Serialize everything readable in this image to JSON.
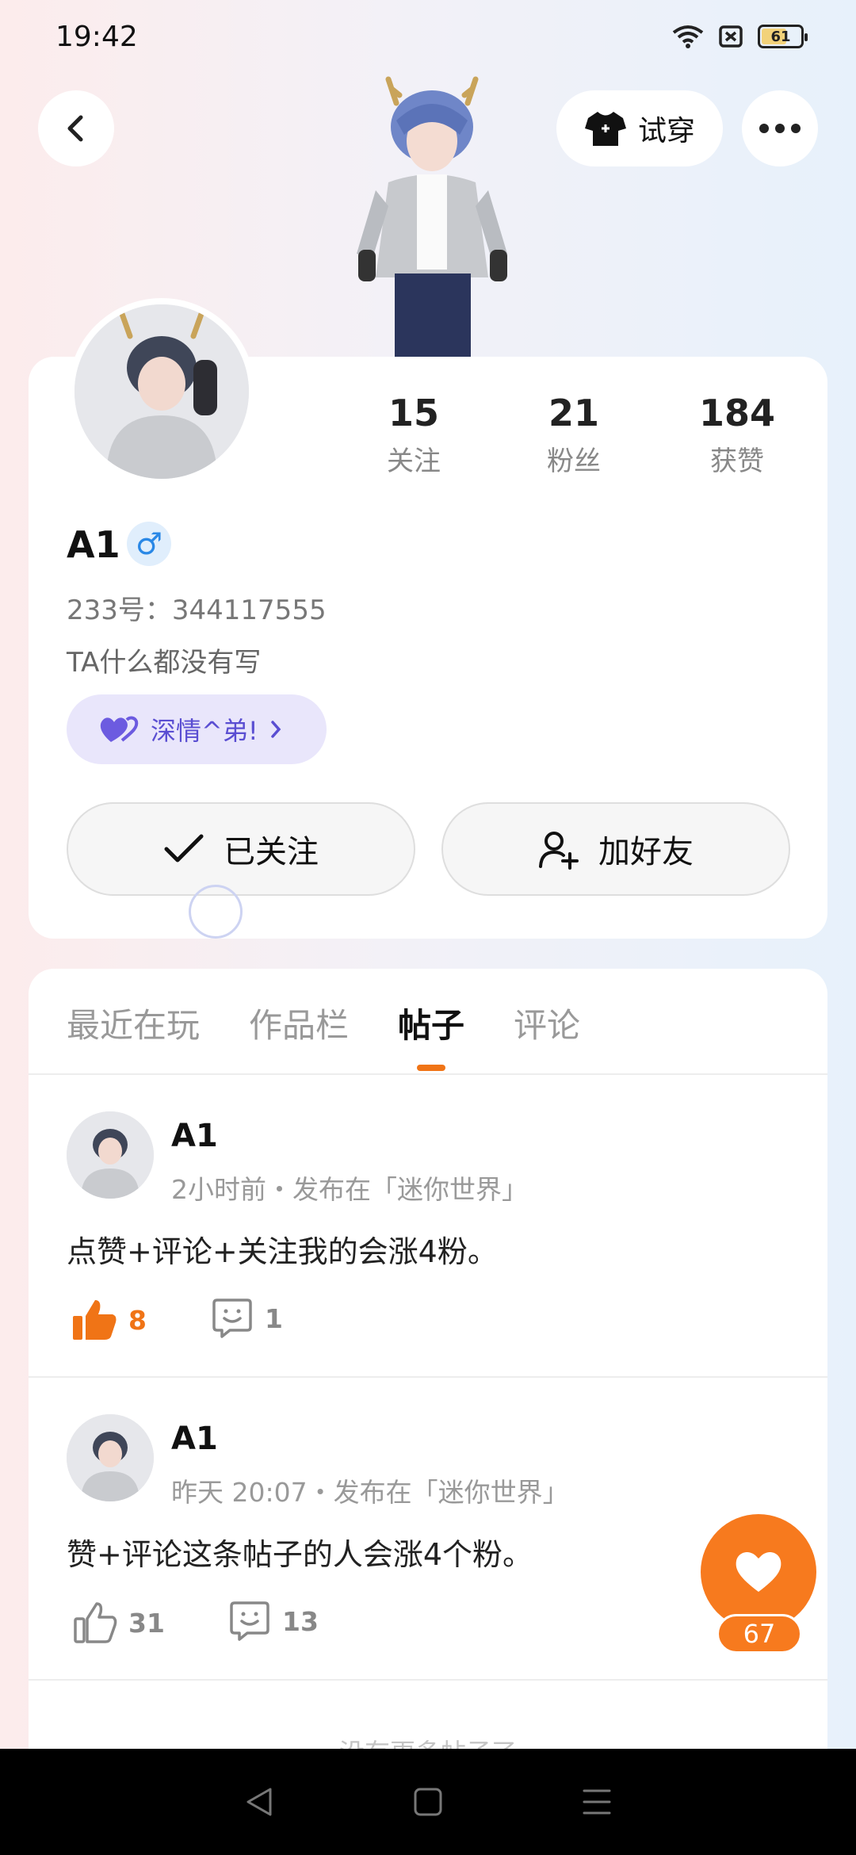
{
  "status_bar": {
    "time": "19:42",
    "battery": "61",
    "icons": [
      "wifi-icon",
      "sim-blocked-icon",
      "battery-icon"
    ]
  },
  "header": {
    "try_on_label": "试穿",
    "icons": [
      "back-arrow-icon",
      "tshirt-icon",
      "more-icon"
    ]
  },
  "profile": {
    "stats": [
      {
        "value": "15",
        "label": "关注"
      },
      {
        "value": "21",
        "label": "粉丝"
      },
      {
        "value": "184",
        "label": "获赞"
      }
    ],
    "name": "A1",
    "gender_symbol": "♂",
    "uid": "233号：344117555",
    "bio": "TA什么都没有写",
    "cp_tag": "深情^弟!",
    "follow_button": "已关注",
    "add_friend_button": "加好友"
  },
  "tabs": [
    "最近在玩",
    "作品栏",
    "帖子",
    "评论"
  ],
  "active_tab": "帖子",
  "posts": [
    {
      "author": "A1",
      "meta": "2小时前・发布在「迷你世界」",
      "text": "点赞+评论+关注我的会涨4粉。",
      "likes": "8",
      "comments": "1",
      "liked": true
    },
    {
      "author": "A1",
      "meta": "昨天 20:07・发布在「迷你世界」",
      "text": "赞+评论这条帖子的人会涨4个粉。",
      "likes": "31",
      "comments": "13",
      "liked": false
    }
  ],
  "footer_text": "没有更多帖子了",
  "fab": {
    "count": "67"
  },
  "colors": {
    "accent": "#f77a1e",
    "tag_bg": "#e9e6fb",
    "tag_text": "#5a4ed2",
    "gender": "#2a88e6"
  }
}
